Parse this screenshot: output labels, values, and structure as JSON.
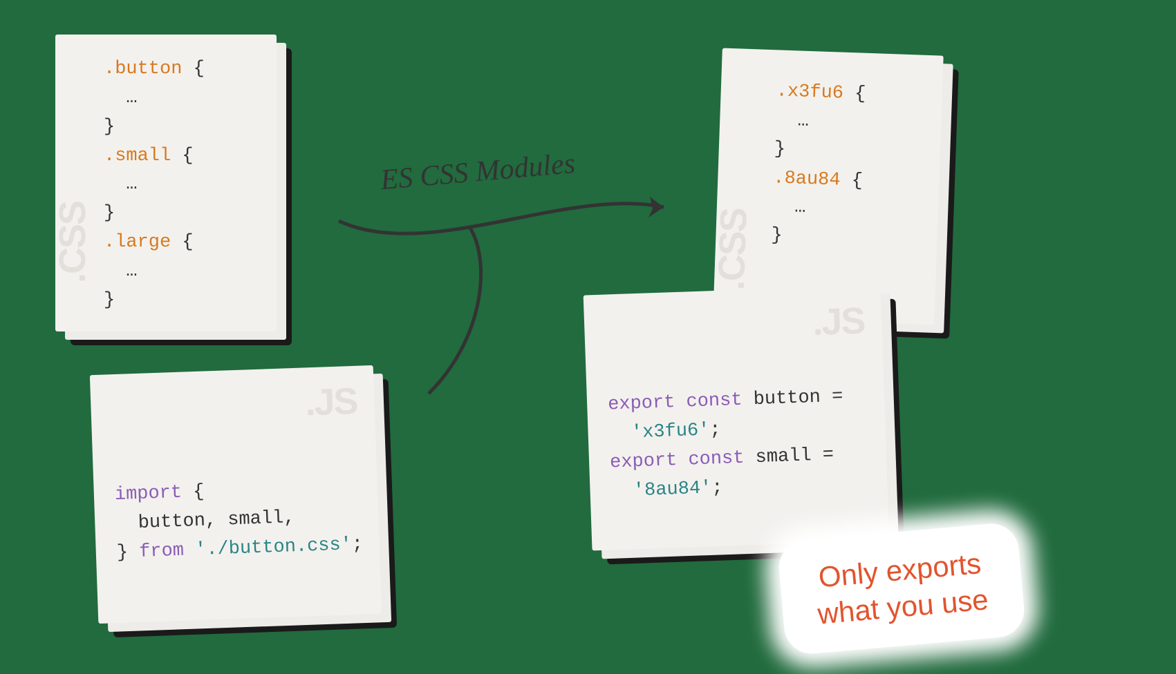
{
  "diagram": {
    "arrow_label": "ES CSS Modules",
    "callout_line1": "Only exports",
    "callout_line2": "what you use"
  },
  "files": {
    "input_css": {
      "watermark": ".CSS",
      "sel1": ".button",
      "sel2": ".small",
      "sel3": ".large",
      "brace_open": " {",
      "brace_close": "}",
      "ellipsis": "  …"
    },
    "input_js": {
      "watermark": ".JS",
      "kw_import": "import",
      "brace_open": " {",
      "ids": "  button, small,",
      "brace_close": "} ",
      "kw_from": "from",
      "path": " './button.css'",
      "semi": ";"
    },
    "output_css": {
      "watermark": ".CSS",
      "sel1": ".x3fu6",
      "sel2": ".8au84",
      "brace_open": " {",
      "brace_close": "}",
      "ellipsis": "  …"
    },
    "output_js": {
      "watermark": ".JS",
      "kw_export1": "export",
      "kw_const1": " const",
      "id1": " button ",
      "eq": "=",
      "val1": "  'x3fu6'",
      "semi": ";",
      "kw_export2": "export",
      "kw_const2": " const",
      "id2": " small ",
      "val2": "  '8au84'"
    }
  }
}
